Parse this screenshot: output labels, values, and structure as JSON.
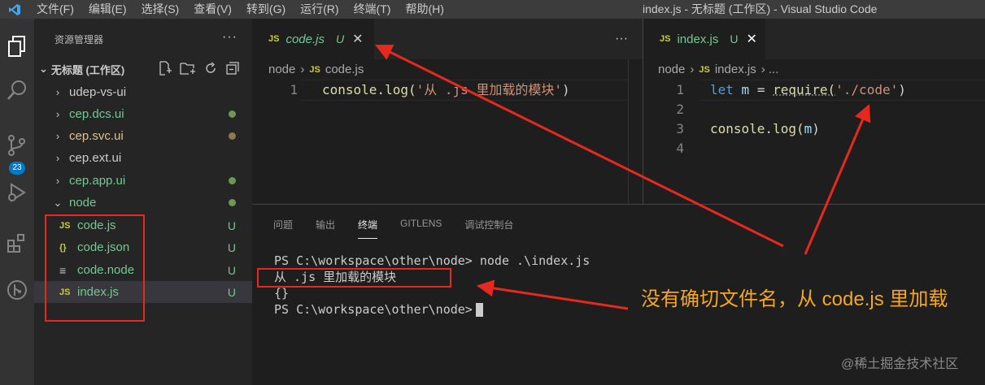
{
  "menu": [
    "文件(F)",
    "编辑(E)",
    "选择(S)",
    "查看(V)",
    "转到(G)",
    "运行(R)",
    "终端(T)",
    "帮助(H)"
  ],
  "window_title": "index.js - 无标题 (工作区) - Visual Studio Code",
  "activity": {
    "badge": "23"
  },
  "explorer": {
    "title": "资源管理器",
    "more": "···",
    "workspace": "无标题 (工作区)",
    "folders": [
      {
        "name": "udep-vs-ui",
        "dot": ""
      },
      {
        "name": "cep.dcs.ui",
        "dot": "#6a9955"
      },
      {
        "name": "cep.svc.ui",
        "dot": "#8b7b4c"
      },
      {
        "name": "cep.ext.ui",
        "dot": ""
      },
      {
        "name": "cep.app.ui",
        "dot": "#6a9955"
      },
      {
        "name": "node",
        "dot": "#6a9955"
      }
    ],
    "files": [
      {
        "icon": "JS",
        "name": "code.js",
        "status": "U"
      },
      {
        "icon": "{}",
        "name": "code.json",
        "status": "U"
      },
      {
        "icon": "≡",
        "name": "code.node",
        "status": "U"
      },
      {
        "icon": "JS",
        "name": "index.js",
        "status": "U"
      }
    ]
  },
  "editor1": {
    "tab": {
      "icon": "JS",
      "name": "code.js",
      "status": "U",
      "close": "✕"
    },
    "more": "···",
    "breadcrumb": {
      "folder": "node",
      "sep": "›",
      "icon": "JS",
      "file": "code.js"
    },
    "lines": [
      {
        "num": "1",
        "fn": "console.log(",
        "str": "'从 .js 里加载的模块'",
        "end": ")"
      }
    ]
  },
  "editor2": {
    "tab": {
      "icon": "JS",
      "name": "index.js",
      "status": "U",
      "close": "✕"
    },
    "breadcrumb": {
      "folder": "node",
      "sep": "›",
      "icon": "JS",
      "file": "index.js",
      "more": "› ..."
    },
    "lines": [
      {
        "num": "1",
        "kw": "let",
        "var": "m",
        "eq": " = ",
        "fn": "require(",
        "str": "'./code'",
        "end": ")"
      },
      {
        "num": "2"
      },
      {
        "num": "3",
        "fn": "console.log(",
        "var": "m",
        "end": ")"
      },
      {
        "num": "4"
      }
    ]
  },
  "panel": {
    "tabs": [
      "问题",
      "输出",
      "终端",
      "GITLENS",
      "调试控制台"
    ],
    "active_tab": "终端",
    "terminal": [
      "PS C:\\workspace\\other\\node> node .\\index.js",
      "从 .js 里加载的模块",
      "{}",
      "PS C:\\workspace\\other\\node>"
    ]
  },
  "annotation": "没有确切文件名，从 code.js 里加载",
  "watermark": "@稀土掘金技术社区",
  "colors": {
    "annotation_red": "#e5291f",
    "annotation_text": "#f5a623",
    "untracked": "#73c991"
  }
}
